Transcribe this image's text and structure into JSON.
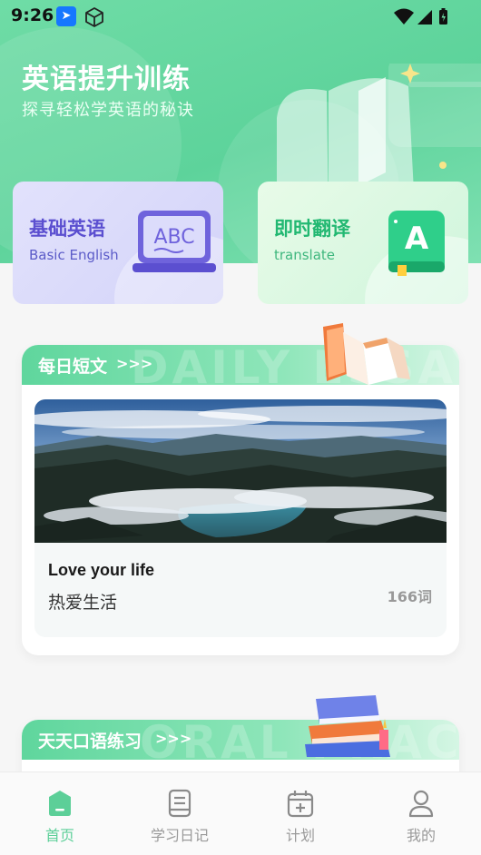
{
  "status_bar": {
    "time": "9:26"
  },
  "hero": {
    "title": "英语提升训练",
    "subtitle": "探寻轻松学英语的秘诀"
  },
  "feature_cards": [
    {
      "title": "基础英语",
      "subtitle": "Basic English",
      "icon": "abc-laptop-icon"
    },
    {
      "title": "即时翻译",
      "subtitle": "translate",
      "icon": "letter-a-book-icon"
    }
  ],
  "daily_essay": {
    "header": "每日短文",
    "arrows": ">>>",
    "watermark": "DAILY ESSAY",
    "article": {
      "title_en": "Love your life",
      "title_zh": "热爱生活",
      "word_count": "166词"
    }
  },
  "oral_practice": {
    "header": "天天口语练习",
    "arrows": ">>>",
    "watermark": "ORAL PRACTICE"
  },
  "tabbar": {
    "items": [
      {
        "label": "首页",
        "icon": "home-icon",
        "active": true
      },
      {
        "label": "学习日记",
        "icon": "diary-icon",
        "active": false
      },
      {
        "label": "计划",
        "icon": "calendar-plan-icon",
        "active": false
      },
      {
        "label": "我的",
        "icon": "profile-icon",
        "active": false
      }
    ]
  },
  "colors": {
    "primary_green": "#5dd39b",
    "active_tab": "#5ccf98",
    "basic_card_text": "#5b4fd0",
    "translate_card_text": "#22b872"
  }
}
